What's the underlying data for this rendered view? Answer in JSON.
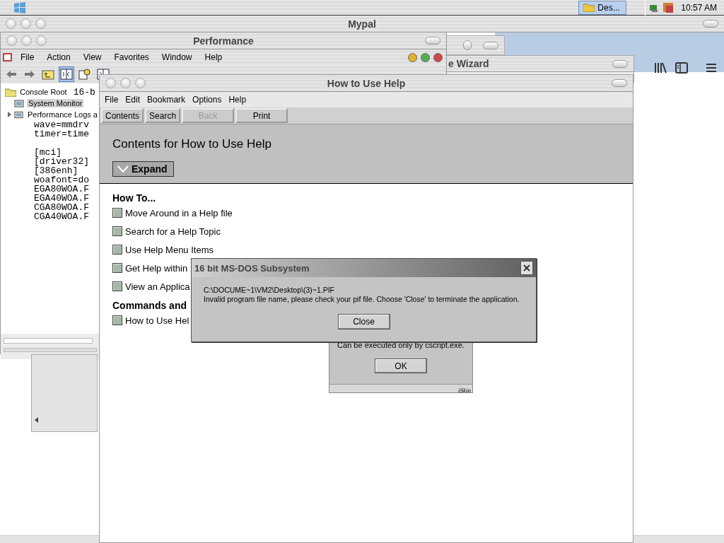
{
  "taskbar": {
    "buttons": [
      {
        "label": "Des...",
        "selected": true
      }
    ],
    "clock": "10:57 AM"
  },
  "mypal": {
    "title": "Mypal"
  },
  "performance": {
    "title": "Performance",
    "menu": [
      "File",
      "Action",
      "View",
      "Favorites",
      "Window",
      "Help"
    ],
    "toolbar": [
      {
        "kind": "back",
        "selected": false
      },
      {
        "kind": "forward",
        "selected": false
      },
      {
        "kind": "up",
        "selected": false
      },
      {
        "kind": "pane",
        "selected": true
      },
      {
        "kind": "help",
        "selected": false
      },
      {
        "kind": "split",
        "selected": false
      }
    ],
    "tree": [
      {
        "label": "Console Root",
        "selected": false,
        "children": [
          {
            "label": "System Monitor",
            "selected": true
          },
          {
            "label": "Performance Logs a",
            "selected": false
          }
        ]
      }
    ],
    "notepad": {
      "corner": "16-b",
      "blocks": [
        [
          "wave=mmdrv",
          "timer=time"
        ],
        [
          "[mci]",
          "[driver32]",
          "[386enh]",
          "woafont=do",
          "EGA80WOA.F",
          "EGA40WOA.F",
          "CGA80WOA.F",
          "CGA40WOA.F"
        ]
      ]
    }
  },
  "wizard": {
    "title": "e Wizard"
  },
  "help": {
    "title": "How to Use Help",
    "menu": [
      "File",
      "Edit",
      "Bookmark",
      "Options",
      "Help"
    ],
    "buttons": [
      {
        "label": "Contents",
        "disabled": false
      },
      {
        "label": "Search",
        "disabled": false
      },
      {
        "label": "Back",
        "disabled": true
      },
      {
        "label": "Print",
        "disabled": false
      }
    ],
    "heading": "Contents for How to Use Help",
    "expand": "Expand",
    "sections": [
      {
        "title": "How To...",
        "items": [
          "Move Around in a Help file",
          "Search for a Help Topic",
          "Use Help Menu Items",
          "Get Help within",
          "View an Applica"
        ]
      },
      {
        "title": "Commands and",
        "items": [
          "How to Use Hel"
        ]
      }
    ]
  },
  "ok_dialog": {
    "message": "Can be executed only by cscript.exe.",
    "button": "OK",
    "brand": "iSkin"
  },
  "dos_dialog": {
    "title": "16 bit MS-DOS Subsystem",
    "lines": [
      "C:\\DOCUME~1\\VM2\\Desktop\\(3)~1.PIF",
      "Invalid program file name, please check your pif file. Choose 'Close' to terminate the application."
    ],
    "button": "Close"
  }
}
